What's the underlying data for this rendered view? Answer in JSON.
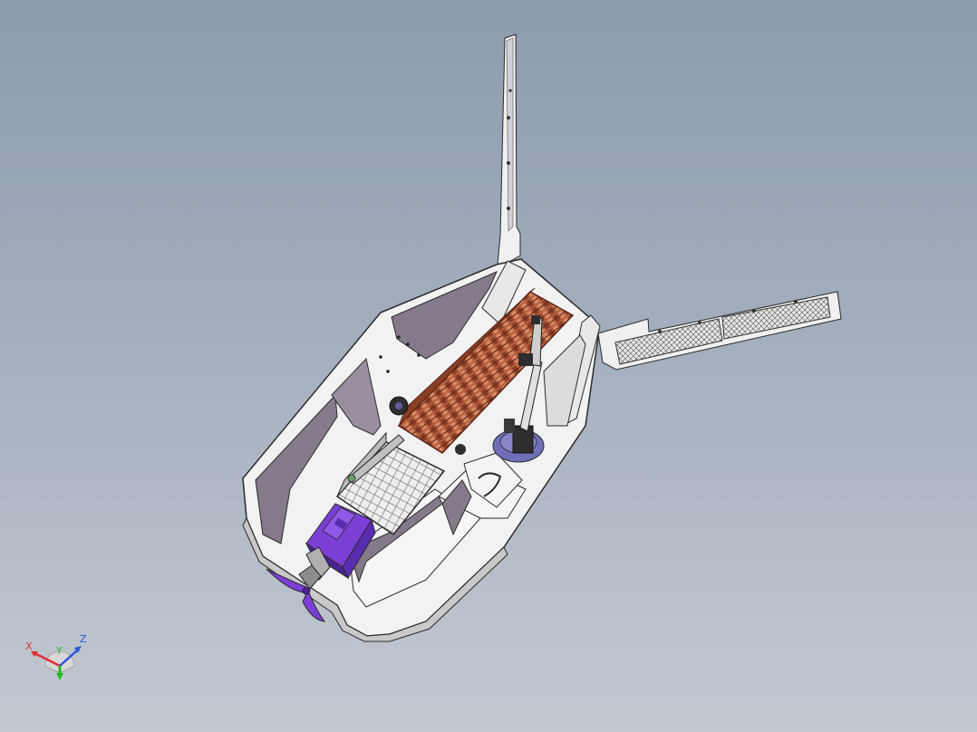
{
  "viewport": {
    "background_top": "#8d9bae",
    "background_bottom": "#c3c9d1"
  },
  "model": {
    "colors": {
      "hull": "#f2f2f2",
      "hull_inner": "#857a8a",
      "hull_edge": "#2a2a2a",
      "conveyor": "#b4603e",
      "conveyor_dark": "#6f3020",
      "motor": "#7b3fd6",
      "motor_dark": "#4a2395",
      "base_plate": "#6f6fb8",
      "grid": "#c9c9c9",
      "rail": "#c0c0c0"
    }
  },
  "triad": {
    "x_label": "X",
    "y_label": "Y",
    "z_label": "Z",
    "x_color": "#e03030",
    "y_color": "#22b822",
    "z_color": "#2a55e0"
  }
}
